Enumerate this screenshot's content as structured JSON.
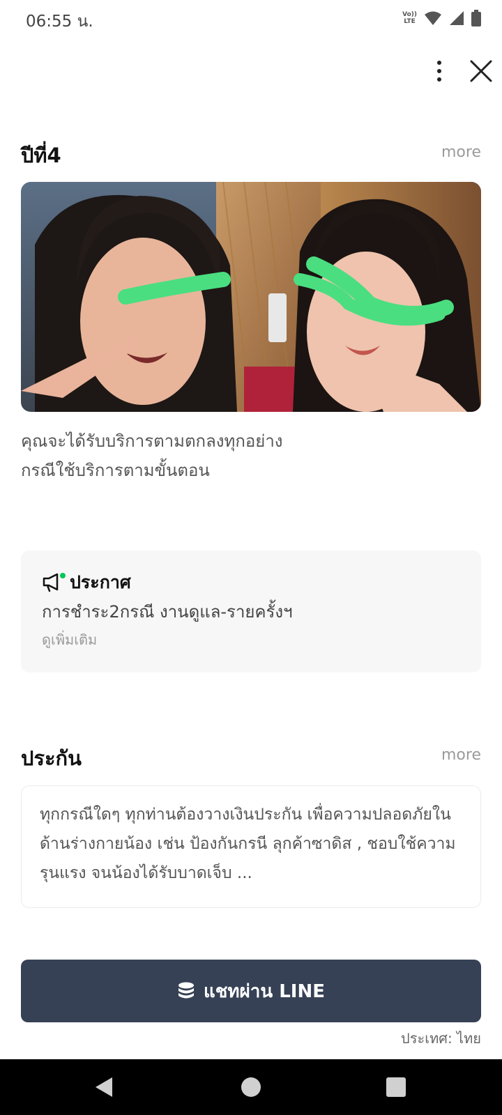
{
  "status_bar": {
    "time": "06:55 น.",
    "volte_top": "Vo))",
    "volte_bottom": "LTE"
  },
  "section1": {
    "title": "ปีที่4",
    "more": "more"
  },
  "photo": {
    "alt": "photo"
  },
  "description": {
    "line1": "คุณจะได้รับบริการตามตกลงทุกอย่าง",
    "line2": "กรณีใช้บริการตามขั้นตอน"
  },
  "notice": {
    "title": "ประกาศ",
    "text": "การชำระ2กรณี งานดูแล-รายครั้งฯ",
    "link": "ดูเพิ่มเติม"
  },
  "section2": {
    "title": "ประกัน",
    "more": "more"
  },
  "info": {
    "text": "ทุกกรณีใดๆ ทุกท่านต้องวางเงินประกัน เพื่อความปลอดภัยในด้านร่างกายน้อง เช่น ป้องกันกรนี ลุกค้าซาดิส , ชอบใช้ความรุนแรง จนน้องได้รับบาดเจ็บ ..."
  },
  "cta": {
    "label": "แชทผ่าน LINE"
  },
  "country": "ประเทศ: ไทย",
  "colors": {
    "cta_bg": "#364155",
    "accent_green": "#06c755",
    "highlight_green": "#4ade80"
  },
  "icons": [
    "volte-icon",
    "wifi-icon",
    "signal-icon",
    "battery-icon",
    "more-vert-icon",
    "close-icon",
    "megaphone-icon",
    "coins-icon",
    "back-icon",
    "home-icon",
    "recents-icon"
  ]
}
